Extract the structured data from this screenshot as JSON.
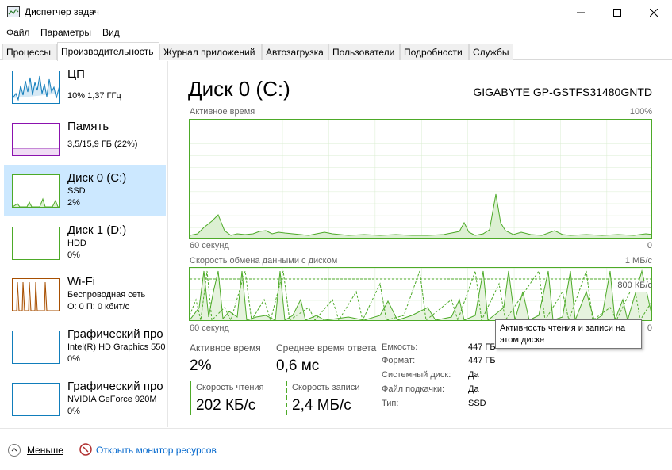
{
  "window": {
    "title": "Диспетчер задач"
  },
  "menu": {
    "file": "Файл",
    "options": "Параметры",
    "view": "Вид"
  },
  "tabs": [
    "Процессы",
    "Производительность",
    "Журнал приложений",
    "Автозагрузка",
    "Пользователи",
    "Подробности",
    "Службы"
  ],
  "sidebar": {
    "items": [
      {
        "title": "ЦП",
        "line1": "10% 1,37 ГГц",
        "line2": "",
        "color": "#117dbb"
      },
      {
        "title": "Память",
        "line1": "3,5/15,9 ГБ (22%)",
        "line2": "",
        "color": "#8b12ae"
      },
      {
        "title": "Диск 0 (C:)",
        "line1": "SSD",
        "line2": "2%",
        "color": "#4daa28"
      },
      {
        "title": "Диск 1 (D:)",
        "line1": "HDD",
        "line2": "0%",
        "color": "#4daa28"
      },
      {
        "title": "Wi-Fi",
        "line1": "Беспроводная сеть",
        "line2": "О: 0 П: 0 кбит/с",
        "color": "#a74f01"
      },
      {
        "title": "Графический про",
        "line1": "Intel(R) HD Graphics 550",
        "line2": "0%",
        "color": "#117dbb"
      },
      {
        "title": "Графический про",
        "line1": "NVIDIA GeForce 920M",
        "line2": "0%",
        "color": "#117dbb"
      }
    ]
  },
  "main": {
    "title": "Диск 0 (C:)",
    "model": "GIGABYTE GP-GSTFS31480GNTD",
    "graph1": {
      "label": "Активное время",
      "max": "100%",
      "time": "60 секунд",
      "min": "0"
    },
    "graph2": {
      "label": "Скорость обмена данными с диском",
      "max": "1 МБ/с",
      "line": "800 КБ/с",
      "time": "60 секунд",
      "min": "0"
    },
    "stats": {
      "active_label": "Активное время",
      "active_value": "2%",
      "response_label": "Среднее время ответа",
      "response_value": "0,6 мс",
      "read_label": "Скорость чтения",
      "read_value": "202 КБ/с",
      "write_label": "Скорость записи",
      "write_value": "2,4 МБ/с"
    },
    "props": [
      {
        "label": "Емкость:",
        "value": "447 ГБ"
      },
      {
        "label": "Формат:",
        "value": "447 ГБ"
      },
      {
        "label": "Системный диск:",
        "value": "Да"
      },
      {
        "label": "Файл подкачки:",
        "value": "Да"
      },
      {
        "label": "Тип:",
        "value": "SSD"
      }
    ],
    "tooltip": "Активность чтения и записи на этом диске"
  },
  "footer": {
    "less": "Меньше",
    "resmon": "Открыть монитор ресурсов"
  },
  "colors": {
    "disk": "#4daa28",
    "cpu": "#117dbb",
    "mem": "#8b12ae",
    "wifi": "#a74f01",
    "selected": "#cce8ff"
  }
}
